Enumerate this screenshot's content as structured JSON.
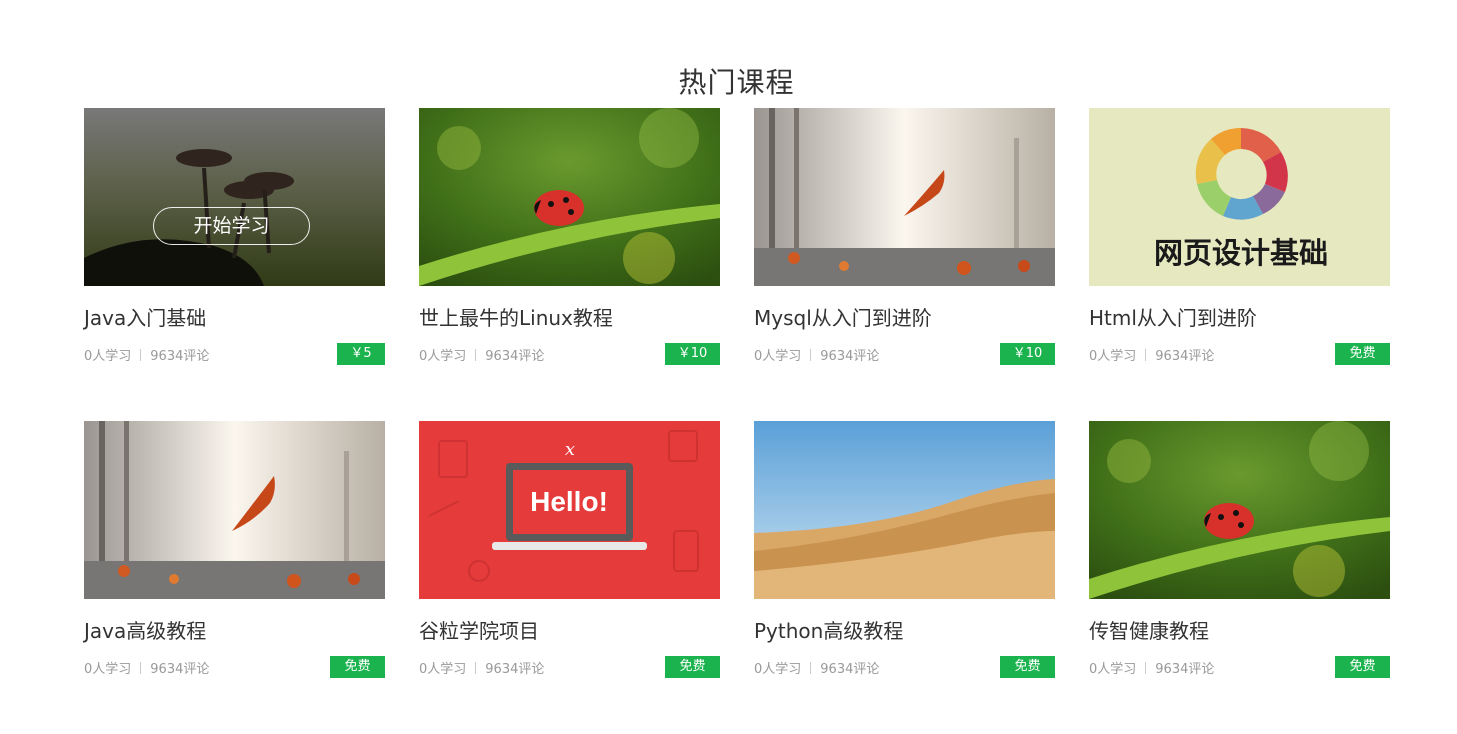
{
  "section": {
    "title": "热门课程"
  },
  "start_label": "开始学习",
  "courses": [
    {
      "title": "Java入门基础",
      "learners": "0人学习",
      "comments": "9634评论",
      "price": "￥5",
      "image": "mushroom-silhouette"
    },
    {
      "title": "世上最牛的Linux教程",
      "learners": "0人学习",
      "comments": "9634评论",
      "price": "￥10",
      "image": "ladybug-on-grass"
    },
    {
      "title": "Mysql从入门到进阶",
      "learners": "0人学习",
      "comments": "9634评论",
      "price": "￥10",
      "image": "autumn-leaf-bridge"
    },
    {
      "title": "Html从入门到进阶",
      "learners": "0人学习",
      "comments": "9634评论",
      "price": "免费",
      "image": "web-design-basics",
      "image_text": "网页设计基础"
    },
    {
      "title": "Java高级教程",
      "learners": "0人学习",
      "comments": "9634评论",
      "price": "免费",
      "image": "autumn-leaf-bridge"
    },
    {
      "title": "谷粒学院项目",
      "learners": "0人学习",
      "comments": "9634评论",
      "price": "免费",
      "image": "hello-laptop",
      "image_text": "Hello!"
    },
    {
      "title": "Python高级教程",
      "learners": "0人学习",
      "comments": "9634评论",
      "price": "免费",
      "image": "desert-dunes"
    },
    {
      "title": "传智健康教程",
      "learners": "0人学习",
      "comments": "9634评论",
      "price": "免费",
      "image": "ladybug-on-grass"
    }
  ],
  "colors": {
    "price_badge": "#1bb34e",
    "title_text": "#333333",
    "meta_text": "#999999"
  }
}
